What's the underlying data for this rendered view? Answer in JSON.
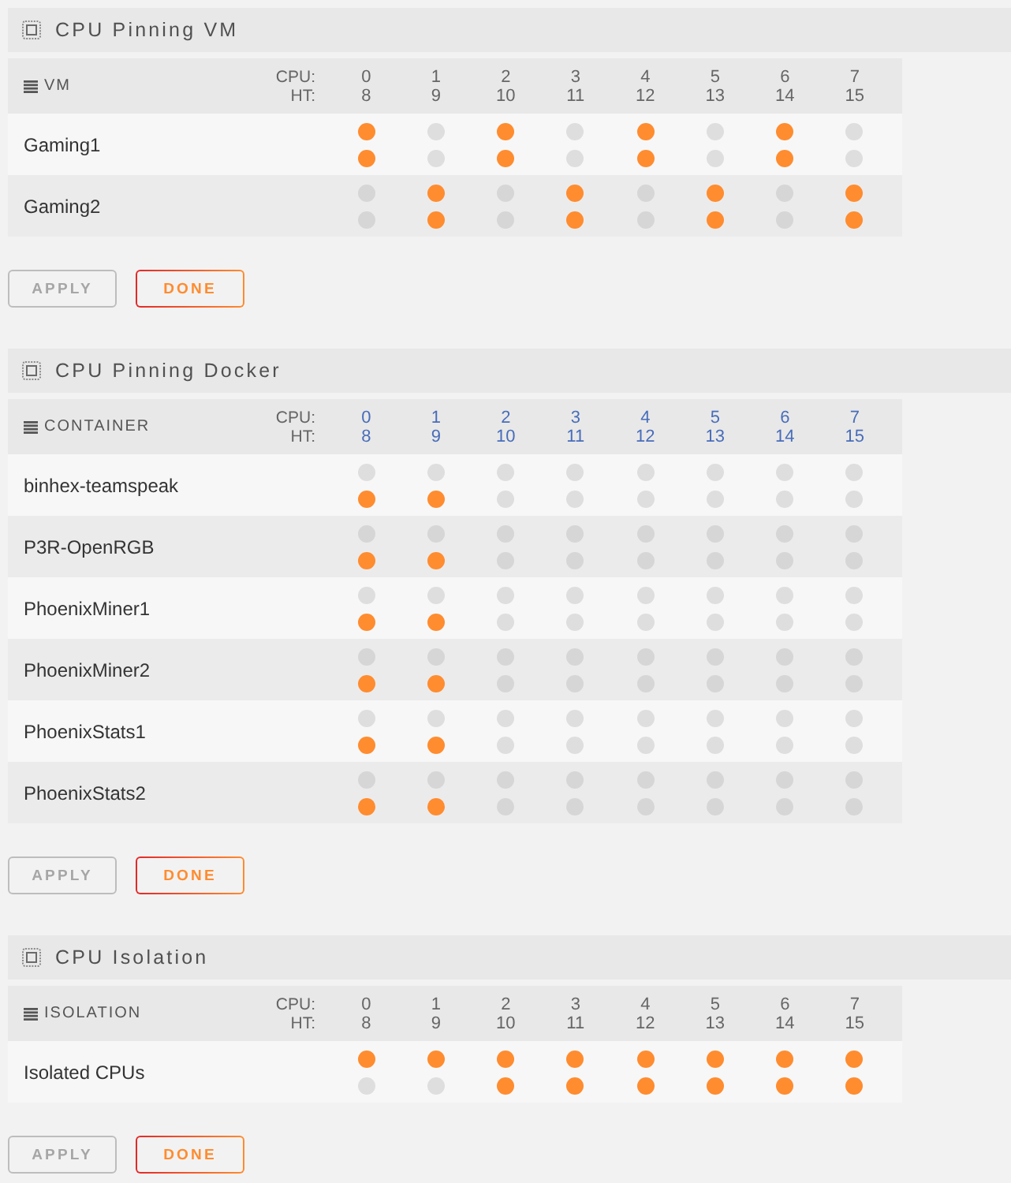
{
  "sections": [
    {
      "title": "CPU Pinning VM",
      "header": "VM",
      "cpu_label": "CPU:",
      "ht_label": "HT:",
      "columns_linked": false,
      "columns": [
        {
          "cpu": "0",
          "ht": "8"
        },
        {
          "cpu": "1",
          "ht": "9"
        },
        {
          "cpu": "2",
          "ht": "10"
        },
        {
          "cpu": "3",
          "ht": "11"
        },
        {
          "cpu": "4",
          "ht": "12"
        },
        {
          "cpu": "5",
          "ht": "13"
        },
        {
          "cpu": "6",
          "ht": "14"
        },
        {
          "cpu": "7",
          "ht": "15"
        }
      ],
      "rows": [
        {
          "name": "Gaming1",
          "cores": [
            {
              "cpu_checked": true,
              "ht_checked": true
            },
            {
              "cpu_checked": false,
              "ht_checked": false
            },
            {
              "cpu_checked": true,
              "ht_checked": true
            },
            {
              "cpu_checked": false,
              "ht_checked": false
            },
            {
              "cpu_checked": true,
              "ht_checked": true
            },
            {
              "cpu_checked": false,
              "ht_checked": false
            },
            {
              "cpu_checked": true,
              "ht_checked": true
            },
            {
              "cpu_checked": false,
              "ht_checked": false
            }
          ]
        },
        {
          "name": "Gaming2",
          "cores": [
            {
              "cpu_checked": false,
              "ht_checked": false
            },
            {
              "cpu_checked": true,
              "ht_checked": true
            },
            {
              "cpu_checked": false,
              "ht_checked": false
            },
            {
              "cpu_checked": true,
              "ht_checked": true
            },
            {
              "cpu_checked": false,
              "ht_checked": false
            },
            {
              "cpu_checked": true,
              "ht_checked": true
            },
            {
              "cpu_checked": false,
              "ht_checked": false
            },
            {
              "cpu_checked": true,
              "ht_checked": true
            }
          ]
        }
      ],
      "buttons": [
        {
          "label": "APPLY",
          "disabled": true
        },
        {
          "label": "DONE",
          "disabled": false
        }
      ]
    },
    {
      "title": "CPU Pinning Docker",
      "header": "CONTAINER",
      "cpu_label": "CPU:",
      "ht_label": "HT:",
      "columns_linked": true,
      "columns": [
        {
          "cpu": "0",
          "ht": "8"
        },
        {
          "cpu": "1",
          "ht": "9"
        },
        {
          "cpu": "2",
          "ht": "10"
        },
        {
          "cpu": "3",
          "ht": "11"
        },
        {
          "cpu": "4",
          "ht": "12"
        },
        {
          "cpu": "5",
          "ht": "13"
        },
        {
          "cpu": "6",
          "ht": "14"
        },
        {
          "cpu": "7",
          "ht": "15"
        }
      ],
      "rows": [
        {
          "name": "binhex-teamspeak",
          "cores": [
            {
              "cpu_checked": false,
              "ht_checked": true
            },
            {
              "cpu_checked": false,
              "ht_checked": true
            },
            {
              "cpu_checked": false,
              "ht_checked": false
            },
            {
              "cpu_checked": false,
              "ht_checked": false
            },
            {
              "cpu_checked": false,
              "ht_checked": false
            },
            {
              "cpu_checked": false,
              "ht_checked": false
            },
            {
              "cpu_checked": false,
              "ht_checked": false
            },
            {
              "cpu_checked": false,
              "ht_checked": false
            }
          ]
        },
        {
          "name": "P3R-OpenRGB",
          "cores": [
            {
              "cpu_checked": false,
              "ht_checked": true
            },
            {
              "cpu_checked": false,
              "ht_checked": true
            },
            {
              "cpu_checked": false,
              "ht_checked": false
            },
            {
              "cpu_checked": false,
              "ht_checked": false
            },
            {
              "cpu_checked": false,
              "ht_checked": false
            },
            {
              "cpu_checked": false,
              "ht_checked": false
            },
            {
              "cpu_checked": false,
              "ht_checked": false
            },
            {
              "cpu_checked": false,
              "ht_checked": false
            }
          ]
        },
        {
          "name": "PhoenixMiner1",
          "cores": [
            {
              "cpu_checked": false,
              "ht_checked": true
            },
            {
              "cpu_checked": false,
              "ht_checked": true
            },
            {
              "cpu_checked": false,
              "ht_checked": false
            },
            {
              "cpu_checked": false,
              "ht_checked": false
            },
            {
              "cpu_checked": false,
              "ht_checked": false
            },
            {
              "cpu_checked": false,
              "ht_checked": false
            },
            {
              "cpu_checked": false,
              "ht_checked": false
            },
            {
              "cpu_checked": false,
              "ht_checked": false
            }
          ]
        },
        {
          "name": "PhoenixMiner2",
          "cores": [
            {
              "cpu_checked": false,
              "ht_checked": true
            },
            {
              "cpu_checked": false,
              "ht_checked": true
            },
            {
              "cpu_checked": false,
              "ht_checked": false
            },
            {
              "cpu_checked": false,
              "ht_checked": false
            },
            {
              "cpu_checked": false,
              "ht_checked": false
            },
            {
              "cpu_checked": false,
              "ht_checked": false
            },
            {
              "cpu_checked": false,
              "ht_checked": false
            },
            {
              "cpu_checked": false,
              "ht_checked": false
            }
          ]
        },
        {
          "name": "PhoenixStats1",
          "cores": [
            {
              "cpu_checked": false,
              "ht_checked": true
            },
            {
              "cpu_checked": false,
              "ht_checked": true
            },
            {
              "cpu_checked": false,
              "ht_checked": false
            },
            {
              "cpu_checked": false,
              "ht_checked": false
            },
            {
              "cpu_checked": false,
              "ht_checked": false
            },
            {
              "cpu_checked": false,
              "ht_checked": false
            },
            {
              "cpu_checked": false,
              "ht_checked": false
            },
            {
              "cpu_checked": false,
              "ht_checked": false
            }
          ]
        },
        {
          "name": "PhoenixStats2",
          "cores": [
            {
              "cpu_checked": false,
              "ht_checked": true
            },
            {
              "cpu_checked": false,
              "ht_checked": true
            },
            {
              "cpu_checked": false,
              "ht_checked": false
            },
            {
              "cpu_checked": false,
              "ht_checked": false
            },
            {
              "cpu_checked": false,
              "ht_checked": false
            },
            {
              "cpu_checked": false,
              "ht_checked": false
            },
            {
              "cpu_checked": false,
              "ht_checked": false
            },
            {
              "cpu_checked": false,
              "ht_checked": false
            }
          ]
        }
      ],
      "buttons": [
        {
          "label": "APPLY",
          "disabled": true
        },
        {
          "label": "DONE",
          "disabled": false
        }
      ]
    },
    {
      "title": "CPU Isolation",
      "header": "ISOLATION",
      "cpu_label": "CPU:",
      "ht_label": "HT:",
      "columns_linked": false,
      "columns": [
        {
          "cpu": "0",
          "ht": "8"
        },
        {
          "cpu": "1",
          "ht": "9"
        },
        {
          "cpu": "2",
          "ht": "10"
        },
        {
          "cpu": "3",
          "ht": "11"
        },
        {
          "cpu": "4",
          "ht": "12"
        },
        {
          "cpu": "5",
          "ht": "13"
        },
        {
          "cpu": "6",
          "ht": "14"
        },
        {
          "cpu": "7",
          "ht": "15"
        }
      ],
      "rows": [
        {
          "name": "Isolated CPUs",
          "cores": [
            {
              "cpu_checked": true,
              "ht_checked": false
            },
            {
              "cpu_checked": true,
              "ht_checked": false
            },
            {
              "cpu_checked": true,
              "ht_checked": true
            },
            {
              "cpu_checked": true,
              "ht_checked": true
            },
            {
              "cpu_checked": true,
              "ht_checked": true
            },
            {
              "cpu_checked": true,
              "ht_checked": true
            },
            {
              "cpu_checked": true,
              "ht_checked": true
            },
            {
              "cpu_checked": true,
              "ht_checked": true
            }
          ]
        }
      ],
      "buttons": [
        {
          "label": "APPLY",
          "disabled": true
        },
        {
          "label": "DONE",
          "disabled": false
        }
      ]
    }
  ]
}
